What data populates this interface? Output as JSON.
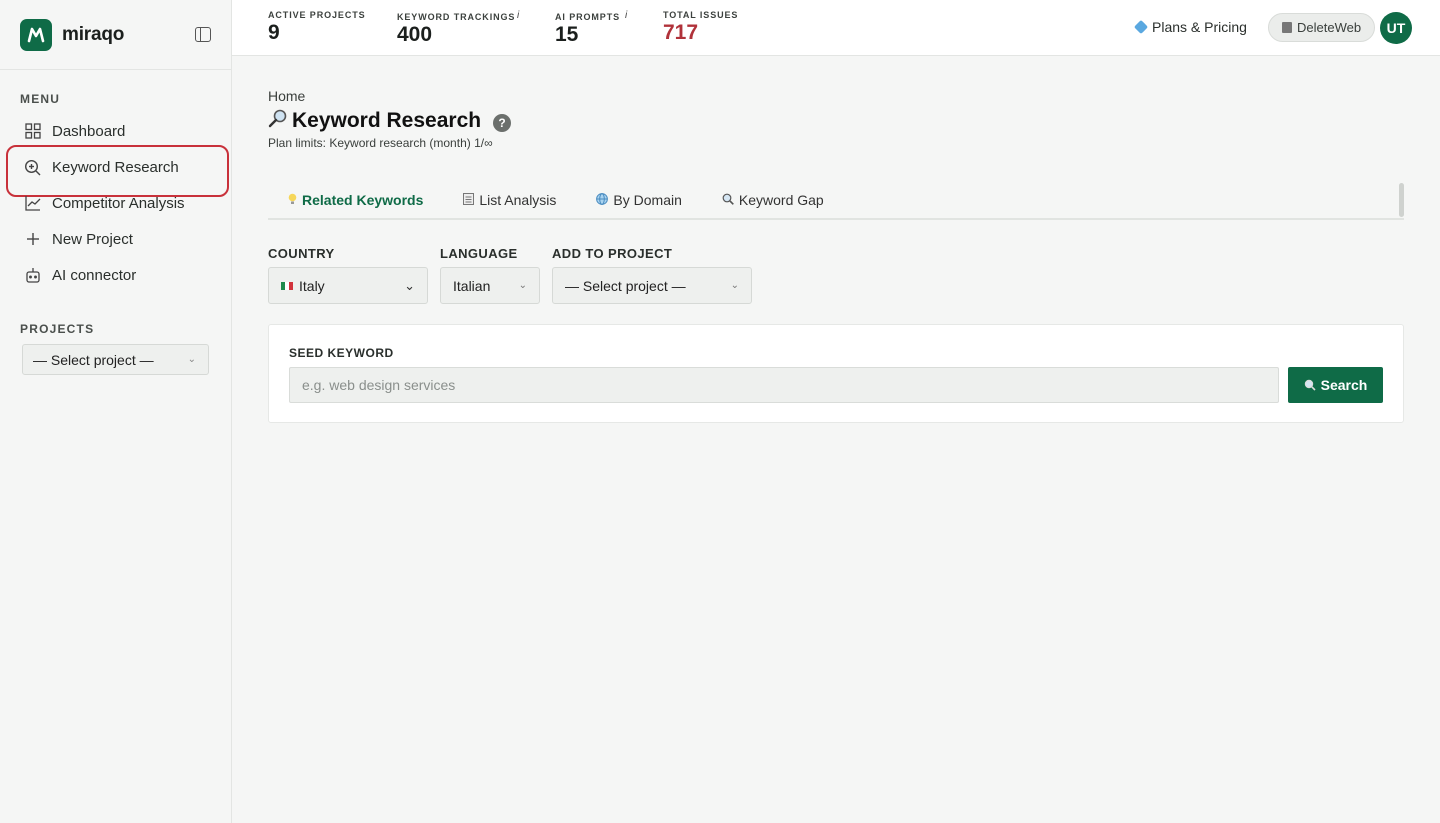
{
  "brand": {
    "name": "miraqo"
  },
  "sidebar": {
    "menu_label": "MENU",
    "items": [
      {
        "label": "Dashboard",
        "icon": "grid-icon"
      },
      {
        "label": "Keyword Research",
        "icon": "search-zoom-icon",
        "active": true
      },
      {
        "label": "Competitor Analysis",
        "icon": "chart-line-icon"
      },
      {
        "label": "New Project",
        "icon": "plus-icon"
      },
      {
        "label": "AI connector",
        "icon": "robot-icon"
      }
    ],
    "projects_label": "PROJECTS",
    "project_select": "— Select project —"
  },
  "topbar": {
    "stats": [
      {
        "label": "ACTIVE PROJECTS",
        "value": "9"
      },
      {
        "label": "KEYWORD TRACKINGS",
        "value": "400",
        "info": "i"
      },
      {
        "label": "AI PROMPTS",
        "value": "15",
        "info": "i"
      },
      {
        "label": "TOTAL ISSUES",
        "value": "717"
      }
    ],
    "plans_label": "Plans & Pricing",
    "workspace": "DeleteWeb",
    "avatar_initials": "UT"
  },
  "page": {
    "breadcrumb": "Home",
    "title": "Keyword Research",
    "help": "?",
    "plan_limits": "Plan limits: Keyword research (month) 1/∞"
  },
  "tabs": [
    {
      "label": "Related Keywords",
      "icon": "bulb-icon",
      "active": true
    },
    {
      "label": "List Analysis",
      "icon": "clipboard-icon"
    },
    {
      "label": "By Domain",
      "icon": "globe-icon"
    },
    {
      "label": "Keyword Gap",
      "icon": "magnifier-icon"
    }
  ],
  "filters": {
    "country_label": "COUNTRY",
    "country_value": "Italy",
    "language_label": "LANGUAGE",
    "language_value": "Italian",
    "project_label": "ADD TO PROJECT",
    "project_value": "— Select project —"
  },
  "seed": {
    "label": "SEED KEYWORD",
    "placeholder": "e.g. web design services",
    "button": "Search"
  },
  "colors": {
    "accent": "#0f6b47",
    "issues": "#b0323a",
    "highlight": "#c8313a"
  }
}
